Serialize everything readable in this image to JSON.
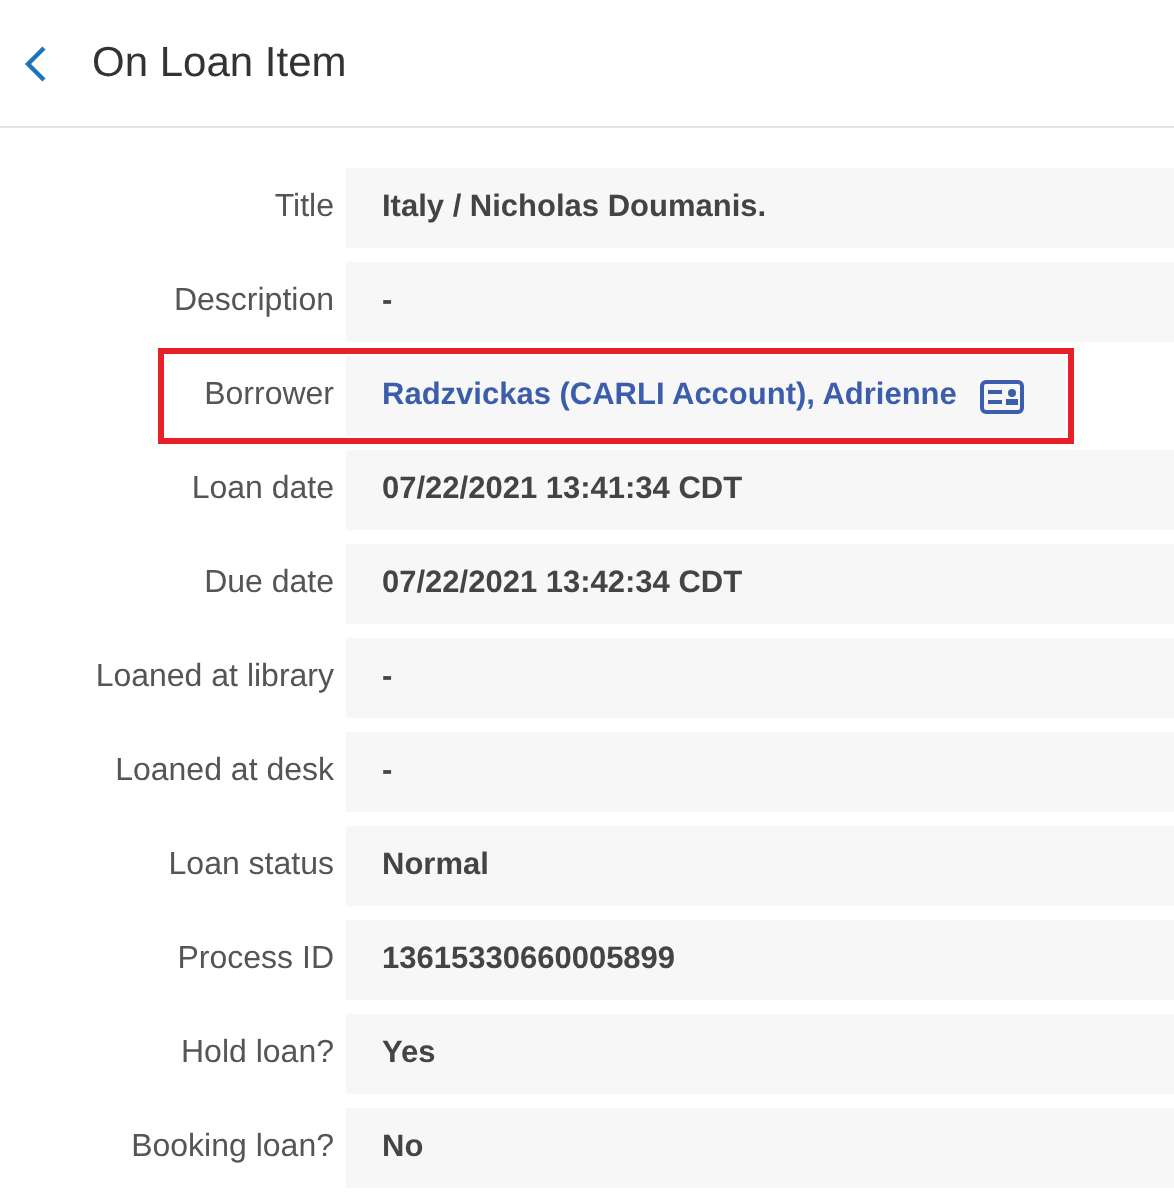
{
  "header": {
    "title": "On Loan Item"
  },
  "fields": [
    {
      "label": "Title",
      "value": "Italy / Nicholas Doumanis.",
      "kind": "text",
      "highlighted": false
    },
    {
      "label": "Description",
      "value": "-",
      "kind": "text",
      "highlighted": false
    },
    {
      "label": "Borrower",
      "value": "Radzvickas (CARLI Account), Adrienne",
      "kind": "link",
      "highlighted": true
    },
    {
      "label": "Loan date",
      "value": "07/22/2021 13:41:34 CDT",
      "kind": "text",
      "highlighted": false
    },
    {
      "label": "Due date",
      "value": "07/22/2021 13:42:34 CDT",
      "kind": "text",
      "highlighted": false
    },
    {
      "label": "Loaned at library",
      "value": "-",
      "kind": "text",
      "highlighted": false
    },
    {
      "label": "Loaned at desk",
      "value": "-",
      "kind": "text",
      "highlighted": false
    },
    {
      "label": "Loan status",
      "value": "Normal",
      "kind": "text",
      "highlighted": false
    },
    {
      "label": "Process ID",
      "value": "13615330660005899",
      "kind": "text",
      "highlighted": false
    },
    {
      "label": "Hold loan?",
      "value": "Yes",
      "kind": "text",
      "highlighted": false
    },
    {
      "label": "Booking loan?",
      "value": "No",
      "kind": "text",
      "highlighted": false
    }
  ]
}
